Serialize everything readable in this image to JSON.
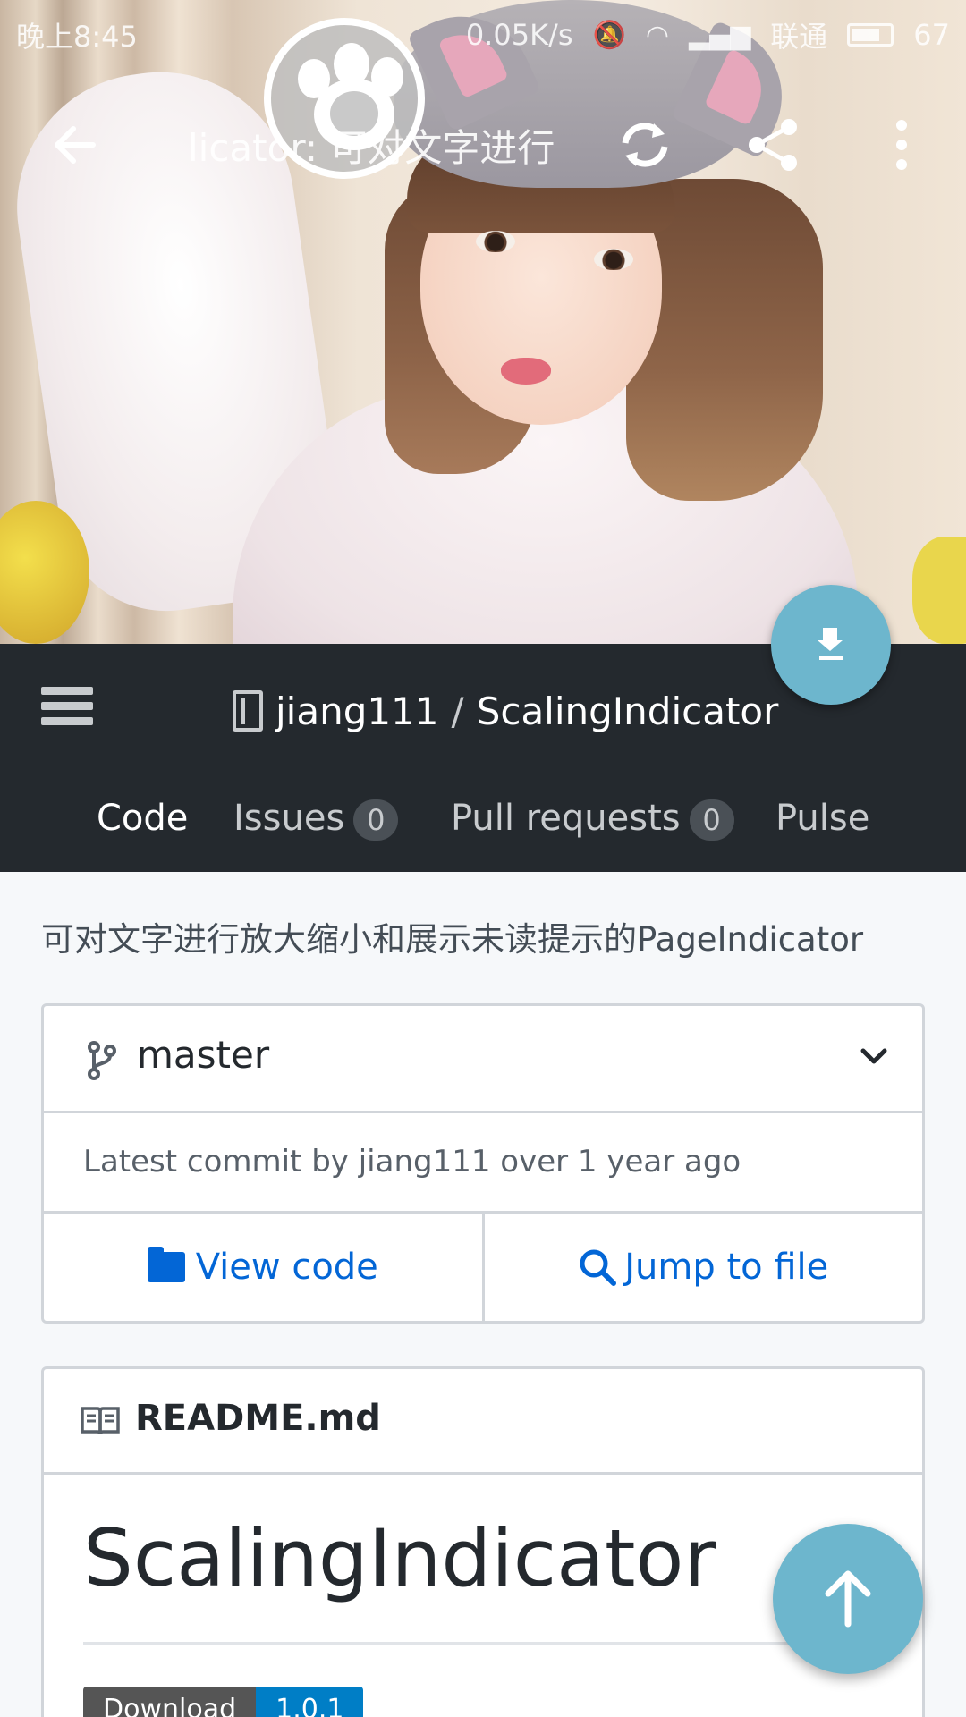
{
  "status_bar": {
    "time": "晚上8:45",
    "network_speed": "0.05K/s",
    "carrier": "联通",
    "battery": "67"
  },
  "toolbar": {
    "title": "licator: 可对文字进行"
  },
  "repo": {
    "owner": "jiang111",
    "separator": "/",
    "name": "ScalingIndicator"
  },
  "tabs": [
    {
      "label": "Code"
    },
    {
      "label": "Issues",
      "count": "0"
    },
    {
      "label": "Pull requests",
      "count": "0"
    },
    {
      "label": "Pulse"
    }
  ],
  "description": "可对文字进行放大缩小和展示未读提示的PageIndicator",
  "branch": {
    "name": "master",
    "latest_commit": "Latest commit by jiang111 over 1 year ago",
    "view_code_label": "View code",
    "jump_to_file_label": "Jump to file"
  },
  "readme": {
    "filename": "README.md",
    "heading": "ScalingIndicator",
    "badge_label": "Download",
    "badge_value": "1.0.1"
  },
  "colors": {
    "header_bg": "#24292e",
    "link_blue": "#0366d6",
    "fab": "#6db6cd"
  },
  "icons": {
    "back": "arrow-left-icon",
    "refresh": "refresh-icon",
    "share": "share-icon",
    "more": "more-vertical-icon",
    "menu": "hamburger-menu-icon",
    "repo": "repo-book-icon",
    "branch": "git-branch-icon",
    "folder": "folder-icon",
    "search": "search-icon",
    "readme": "book-icon",
    "download": "download-icon",
    "scroll_top": "arrow-up-icon"
  }
}
